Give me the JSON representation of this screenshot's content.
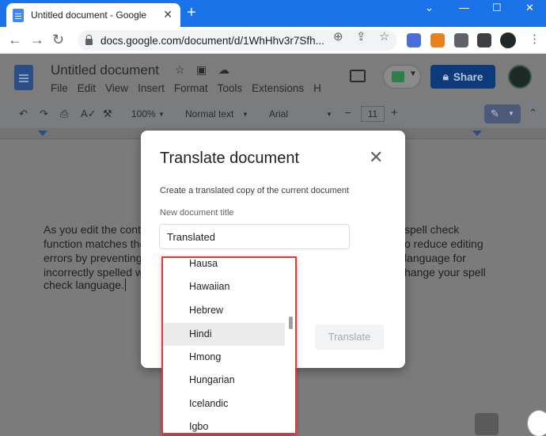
{
  "browser": {
    "tab_title": "Untitled document - Google Doc",
    "new_tab_icon": "+",
    "url": "docs.google.com/document/d/1WhHhv3r7Sfh..."
  },
  "docs": {
    "title": "Untitled document",
    "menu": [
      "File",
      "Edit",
      "View",
      "Insert",
      "Format",
      "Tools",
      "Extensions",
      "H"
    ],
    "share_label": "Share",
    "zoom": "100%",
    "style": "Normal text",
    "font": "Arial",
    "font_size": "11"
  },
  "document": {
    "left_lines": [
      "As you edit the conte",
      "function matches the",
      "errors by preventing",
      "incorrectly spelled w",
      "check language."
    ],
    "right_lines": [
      "spell check",
      "o reduce editing",
      "language for",
      "hange your spell"
    ]
  },
  "dialog": {
    "title": "Translate document",
    "description": "Create a translated copy of the current document",
    "field_label": "New document title",
    "field_value": "Translated",
    "translate_label": "Translate"
  },
  "language_list": {
    "items": [
      "Hausa",
      "Hawaiian",
      "Hebrew",
      "Hindi",
      "Hmong",
      "Hungarian",
      "Icelandic",
      "Igbo"
    ],
    "selected": "Hindi"
  },
  "colors": {
    "chrome_blue": "#1a73e8",
    "share_button": "#0c3a7a",
    "highlight": "#e53935"
  }
}
